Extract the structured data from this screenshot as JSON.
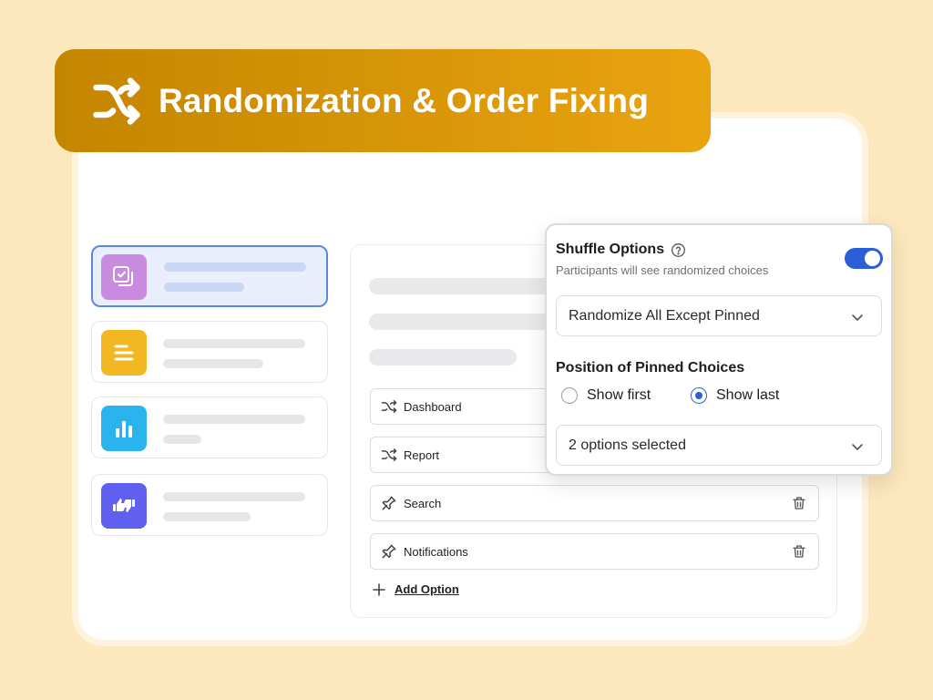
{
  "banner": {
    "title": "Randomization & Order Fixing",
    "icon": "shuffle-icon"
  },
  "colors": {
    "accent": "#2b5fd8",
    "banner_start": "#c48500",
    "banner_end": "#e9a40f",
    "background": "#fde8bd"
  },
  "question_types": [
    {
      "icon": "multi-choice-icon",
      "color": "#c98be0",
      "selected": true
    },
    {
      "icon": "text-lines-icon",
      "color": "#f3b722",
      "selected": false
    },
    {
      "icon": "bar-chart-icon",
      "color": "#2ab4ee",
      "selected": false
    },
    {
      "icon": "thumbs-rating-icon",
      "color": "#5f5ff0",
      "selected": false
    }
  ],
  "options": [
    {
      "label": "Dashboard",
      "icon": "shuffle-icon"
    },
    {
      "label": "Report",
      "icon": "shuffle-icon"
    },
    {
      "label": "Search",
      "icon": "pin-icon"
    },
    {
      "label": "Notifications",
      "icon": "pin-icon"
    }
  ],
  "add_option": {
    "label": "Add Option"
  },
  "popover": {
    "title": "Shuffle Options",
    "subtitle": "Participants will see randomized choices",
    "toggle_on": true,
    "randomize_mode": "Randomize All Except Pinned",
    "position_title": "Position of Pinned Choices",
    "radio_options": [
      {
        "label": "Show first",
        "selected": false
      },
      {
        "label": "Show last",
        "selected": true
      }
    ],
    "selected_summary": "2 options selected"
  }
}
